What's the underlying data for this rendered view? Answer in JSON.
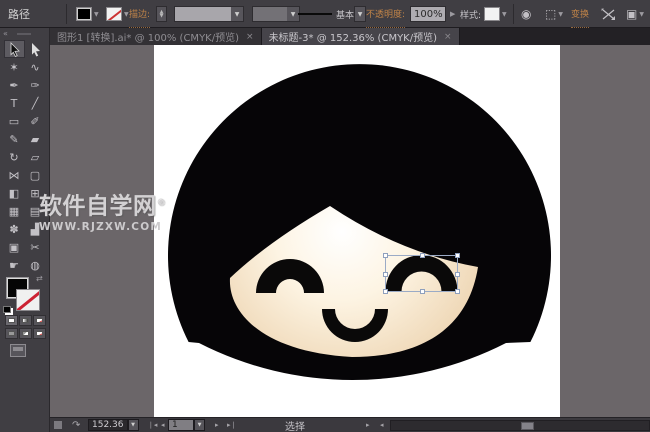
{
  "control_bar": {
    "selection_type_label": "路径",
    "stroke_label": "描边:",
    "brush_label": "基本",
    "opacity_label": "不透明度:",
    "opacity_value": "100%",
    "style_label": "样式:",
    "transform_label": "变换",
    "stepper_up": "▲",
    "stepper_down": "▼",
    "dropdown_arrow": "▼",
    "spin_arrow": "▶"
  },
  "tabs": [
    {
      "title": "图形1 [转换].ai* @ 100% (CMYK/预览)",
      "close": "×"
    },
    {
      "title": "未标题-3* @ 152.36% (CMYK/预览)",
      "close": "×"
    }
  ],
  "toolbar": {
    "collapse_chevron": "«",
    "tools": [
      {
        "name": "selection-tool",
        "glyph": ""
      },
      {
        "name": "direct-selection-tool",
        "glyph": ""
      },
      {
        "name": "magic-wand-tool",
        "glyph": "✶"
      },
      {
        "name": "lasso-tool",
        "glyph": "∿"
      },
      {
        "name": "pen-tool",
        "glyph": "✒"
      },
      {
        "name": "curvature-pen-tool",
        "glyph": "✑"
      },
      {
        "name": "type-tool",
        "glyph": "T"
      },
      {
        "name": "line-segment-tool",
        "glyph": "╱"
      },
      {
        "name": "rectangle-tool",
        "glyph": "▭"
      },
      {
        "name": "paintbrush-tool",
        "glyph": "✐"
      },
      {
        "name": "pencil-tool",
        "glyph": "✎"
      },
      {
        "name": "eraser-tool",
        "glyph": "▰"
      },
      {
        "name": "rotate-tool",
        "glyph": "↻"
      },
      {
        "name": "scale-tool",
        "glyph": "▱"
      },
      {
        "name": "width-tool",
        "glyph": "⋈"
      },
      {
        "name": "free-transform-tool",
        "glyph": "▢"
      },
      {
        "name": "shape-builder-tool",
        "glyph": "◧"
      },
      {
        "name": "perspective-grid-tool",
        "glyph": "⊞"
      },
      {
        "name": "mesh-tool",
        "glyph": "▦"
      },
      {
        "name": "gradient-tool",
        "glyph": "▤"
      },
      {
        "name": "symbol-sprayer-tool",
        "glyph": "✽"
      },
      {
        "name": "graph-tool",
        "glyph": "▟"
      },
      {
        "name": "artboard-tool",
        "glyph": "▣"
      },
      {
        "name": "slice-tool",
        "glyph": "✂"
      },
      {
        "name": "hand-tool",
        "glyph": "☛"
      },
      {
        "name": "zoom-tool",
        "glyph": "◍"
      }
    ]
  },
  "status_bar": {
    "zoom_value": "152.36",
    "artboard_value": "1",
    "tool_status": "选择",
    "nav_first": "◂",
    "nav_prev": "◂",
    "nav_next": "▸",
    "nav_last": "▸"
  },
  "watermark": {
    "title": "软件自学网",
    "registered": "®",
    "url": "WWW.RJZXW.COM"
  },
  "illustration": {
    "hair_color": "#060507",
    "feature_color": "#0a0909",
    "skin_center": "#ffffff",
    "skin_mid": "#fdf4e3",
    "skin_edge": "#eed6b4",
    "selection_color": "#9babc6"
  }
}
